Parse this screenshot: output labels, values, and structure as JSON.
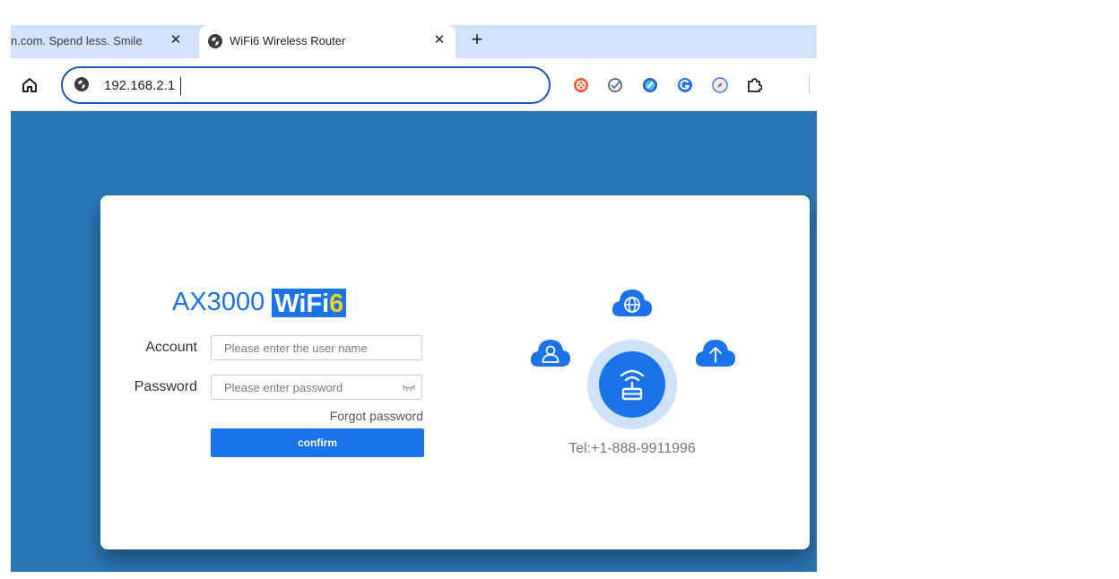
{
  "browser": {
    "tabs": [
      {
        "title": "n.com. Spend less. Smile",
        "active": false
      },
      {
        "title": "WiFi6 Wireless Router",
        "active": true
      }
    ],
    "close_glyph": "✕",
    "new_tab_glyph": "+",
    "address": "192.168.2.1",
    "extensions": [
      "orange-ext-icon",
      "checkmark-ext-icon",
      "compass-ext-icon",
      "blue-g-ext-icon",
      "safari-ext-icon",
      "puzzle-extensions-icon"
    ]
  },
  "colors": {
    "page_background": "#2a76b5",
    "accent": "#1a73e8",
    "brand_highlight": "#f2d21b",
    "tabstrip": "#d3e3fd"
  },
  "login": {
    "brand_prefix": "AX3000",
    "brand_wifi": "WiFi",
    "brand_six": "6",
    "account_label": "Account",
    "account_placeholder": "Please enter the user name",
    "password_label": "Password",
    "password_placeholder": "Please enter password",
    "forgot": "Forgot password",
    "confirm": "confirm"
  },
  "illustration": {
    "icons": [
      "globe-cloud-icon",
      "user-cloud-icon",
      "upload-cloud-icon",
      "router-icon"
    ],
    "tel": "Tel:+1-888-9911996"
  }
}
